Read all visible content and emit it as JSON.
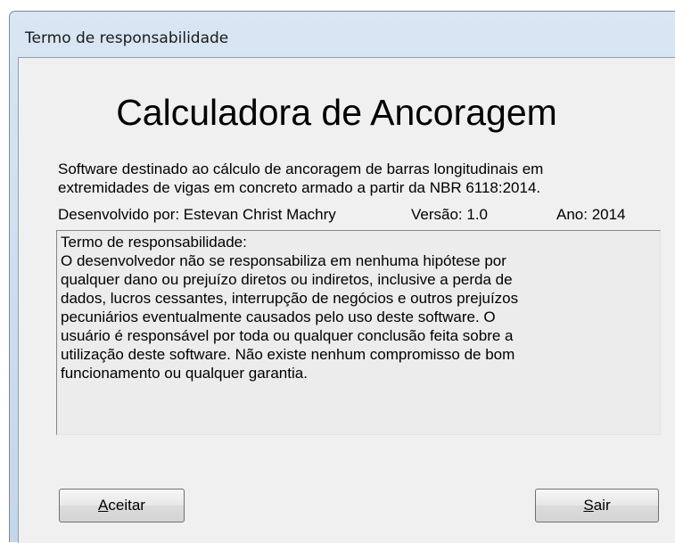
{
  "window": {
    "title": "Termo de responsabilidade"
  },
  "header": {
    "app_title": "Calculadora de Ancoragem",
    "description_lines": [
      "Software destinado ao cálculo de ancoragem de barras longitudinais em",
      "extremidades de vigas em concreto armado a partir da NBR 6118:2014."
    ]
  },
  "info": {
    "developer": "Desenvolvido por: Estevan Christ Machry",
    "version": "Versão: 1.0",
    "year": "Ano: 2014"
  },
  "disclaimer": {
    "lines": [
      "Termo de responsabilidade:",
      "O desenvolvedor não se responsabiliza em nenhuma hipótese por",
      "qualquer dano ou prejuízo diretos ou indiretos, inclusive a perda de",
      "dados, lucros cessantes, interrupção de negócios e outros prejuízos",
      "pecuniários eventualmente causados pelo uso deste software. O",
      "usuário é responsável por toda ou qualquer conclusão feita sobre a",
      "utilização deste software. Não existe nenhum compromisso de bom",
      "funcionamento ou qualquer garantia."
    ]
  },
  "buttons": {
    "accept_mnemonic": "A",
    "accept_rest": "ceitar",
    "exit_mnemonic": "S",
    "exit_rest": "air"
  }
}
